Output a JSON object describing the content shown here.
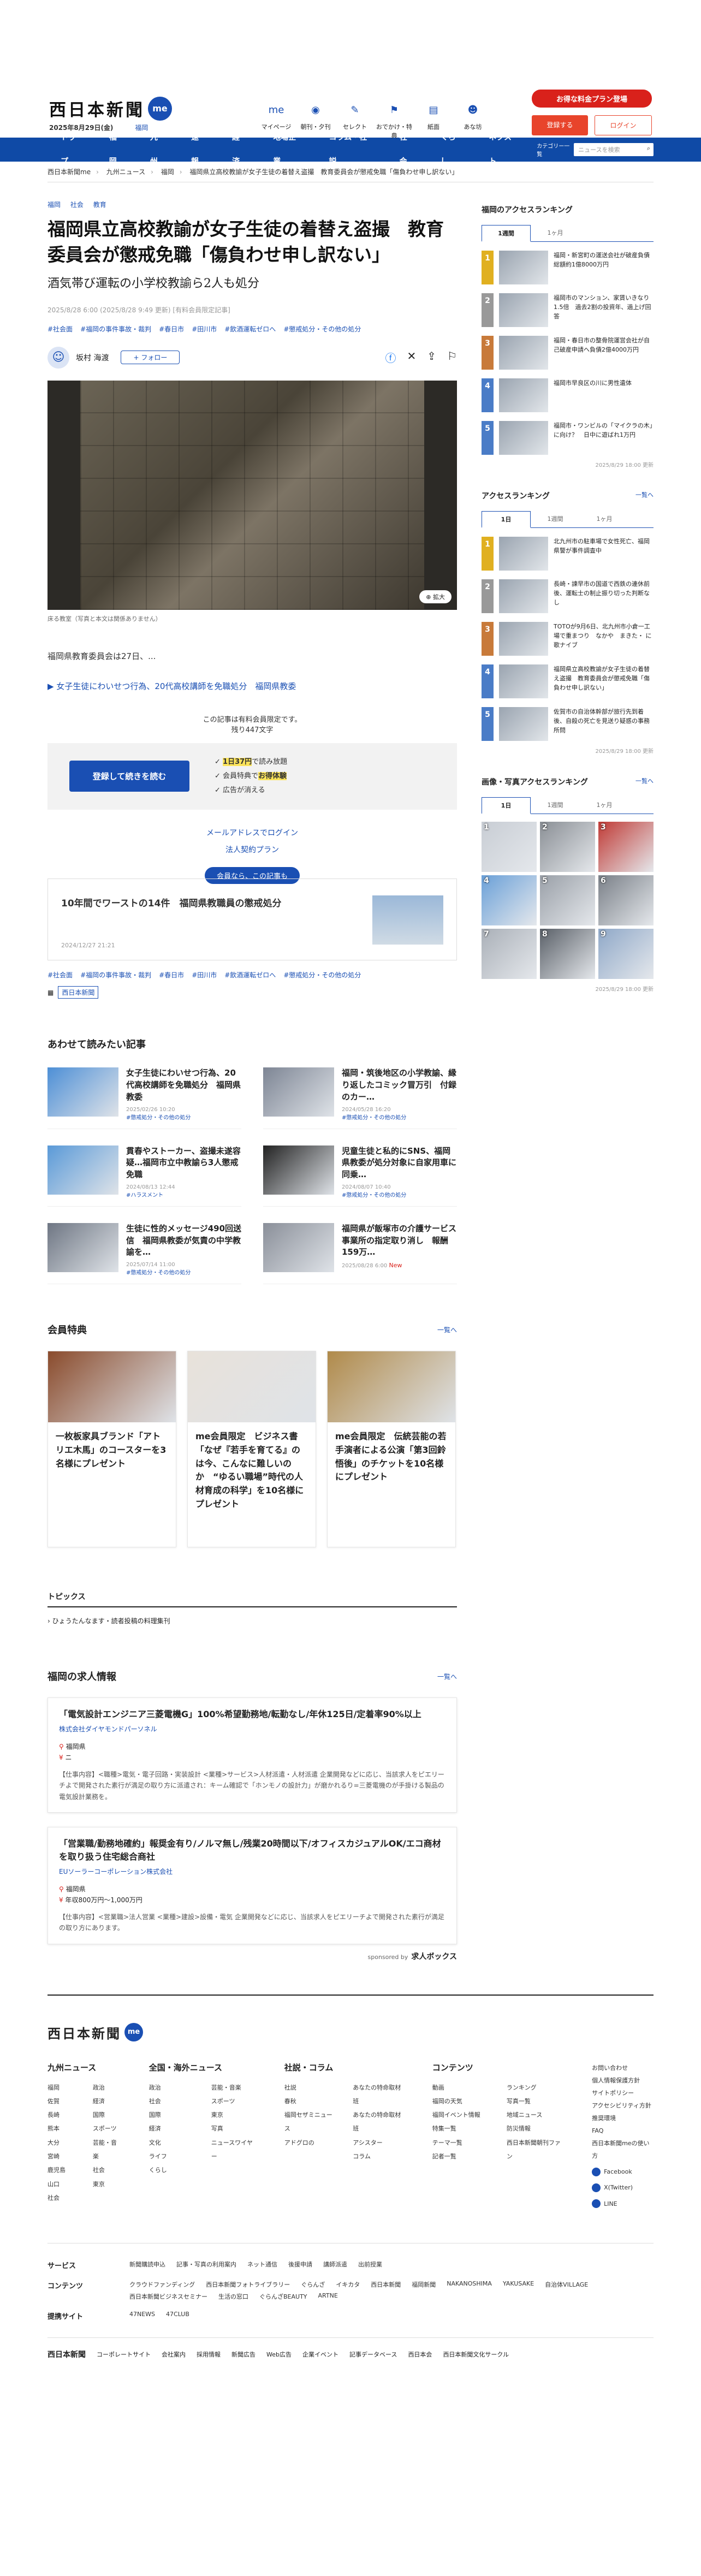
{
  "header": {
    "logo": "西日本新聞",
    "logo_badge": "me",
    "date": "2025年8月29日(金)",
    "region": "福岡",
    "nav": [
      {
        "icon": "my-page-icon",
        "label": "マイページ"
      },
      {
        "icon": "newspaper-icon",
        "label": "朝刊・夕刊"
      },
      {
        "icon": "select-icon",
        "label": "セレクト"
      },
      {
        "icon": "gift-icon",
        "label": "おでかけ・特典"
      },
      {
        "icon": "paper-icon",
        "label": "紙面"
      },
      {
        "icon": "asumaru-icon",
        "label": "あな坊"
      }
    ],
    "promo": "お得な料金プラン登場",
    "register": "登録する",
    "login": "ログイン"
  },
  "gnav": {
    "items": [
      "トップ",
      "福岡",
      "九州",
      "速報",
      "経済",
      "地場企業",
      "コラム・社説",
      "社会",
      "くらし",
      "ネクスト"
    ],
    "more": "カテゴリー一覧",
    "search_placeholder": "ニュースを検索"
  },
  "breadcrumb": [
    "西日本新聞me",
    "九州ニュース",
    "福岡",
    "福岡県立高校教諭が女子生徒の着替え盗撮　教育委員会が懲戒免職「傷負わせ申し訳ない」"
  ],
  "article": {
    "categories": [
      "福岡",
      "社会",
      "教育"
    ],
    "title": "福岡県立高校教諭が女子生徒の着替え盗撮　教育委員会が懲戒免職「傷負わせ申し訳ない」",
    "subtitle": "酒気帯び運転の小学校教諭ら2人も処分",
    "meta": "2025/8/28 6:00 (2025/8/28 9:49 更新) [有料会員限定記事]",
    "tags": [
      "#社会面",
      "#福岡の事件事故・裁判",
      "#春日市",
      "#田川市",
      "#飲酒運転ゼロへ",
      "#懲戒処分・その他の処分"
    ],
    "author": "坂村 海渡",
    "follow": "+ フォロー",
    "zoom": "拡大",
    "caption": "床る教室（写真と本文は関係ありません）",
    "lead": "福岡県教育委員会は27日、...",
    "related_link": "女子生徒にわいせつ行為、20代高校講師を免職処分　福岡県教委",
    "paywall_note1": "この記事は有料会員限定です。",
    "paywall_note2": "残り447文字",
    "paywall_btn": "登録して続きを読む",
    "benefits": [
      "1日37円で読み放題",
      "会員特典でお得体験",
      "広告が消える"
    ],
    "benefit_hl": [
      "1日37円",
      "お得体験"
    ],
    "login_mail": "メールアドレスでログイン",
    "corp_plan": "法人契約プラン",
    "member_badge": "会員なら、この記事も",
    "rec_title": "10年間でワーストの14件　福岡県教職員の懲戒処分",
    "rec_date": "2024/12/27 21:21",
    "tags2": [
      "#社会面",
      "#福岡の事件事故・裁判",
      "#春日市",
      "#田川市",
      "#飲酒運転ゼロへ",
      "#懲戒処分・その他の処分"
    ],
    "source": "西日本新聞"
  },
  "related": {
    "title": "あわせて読みたい記事",
    "items": [
      {
        "title": "女子生徒にわいせつ行為、20代高校講師を免職処分　福岡県教委",
        "date": "2025/02/26 10:20",
        "tag": "#懲戒処分・その他の処分",
        "color": "#4d8fd6"
      },
      {
        "title": "福岡・筑後地区の小学教諭、縁り返したコミック冒万引　付録のカー…",
        "date": "2024/05/28 16:20",
        "tag": "#懲戒処分・その他の処分",
        "color": "#7d8594"
      },
      {
        "title": "貫春やストーカー、盗撮未遂容疑…福岡市立中教諭ら3人懲戒免職",
        "date": "2024/08/13 12:44",
        "tag": "#ハラスメント",
        "color": "#5a9ad8"
      },
      {
        "title": "児童生徒と私的にSNS、福岡県教委が処分対象に自家用車に同乗…",
        "date": "2024/08/07 10:40",
        "tag": "#懲戒処分・その他の処分",
        "color": "#222222"
      },
      {
        "title": "生徒に性的メッセージ490回送信　福岡県教委が気責の中学教諭を…",
        "date": "2025/07/14 11:00",
        "tag": "#懲戒処分・その他の処分",
        "color": "#6e7683"
      },
      {
        "title": "福岡県が飯塚市の介護サービス事業所の指定取り消し　報酬159万…",
        "date": "2025/08/28 6:00",
        "tag": "",
        "new": "New",
        "color": "#8a8f99"
      }
    ]
  },
  "perks": {
    "title": "会員特典",
    "more": "一覧へ",
    "items": [
      {
        "title": "一枚板家具ブランド「アトリエ木馬」のコースターを3名様にプレゼント",
        "color": "#8a4b2c"
      },
      {
        "title": "me会員限定　ビジネス書「なぜ『若手を育てる』のは今、こんなに難しいのか　“ゆるい職場”時代の人材育成の科学」を10名様にプレゼント",
        "color": "#e8e2da"
      },
      {
        "title": "me会員限定　伝統芸能の若手演者による公演「第3回鈴悟後」のチケットを10名様にプレゼント",
        "color": "#b08a4a"
      }
    ]
  },
  "topics": {
    "title": "トピックス",
    "item": "ひょうたんなます・読者投稿の料理集刊"
  },
  "jobs": {
    "title": "福岡の求人情報",
    "more": "一覧へ",
    "items": [
      {
        "title": "「電気設計エンジニア三菱電機G」100%希望勤務地/転勤なし/年休125日/定着率90%以上",
        "company": "株式会社ダイヤモンドパーソネル",
        "place": "福岡県",
        "salary": "ニ",
        "body": "【仕事内容】<職種>電気・電子回路・実装設計 <業種>サービス>人材派遣・人材派遣 企業開発などに応じ、当該求人をピエリーチよで開発された素行が満足の取り方に派遣され：キーム確認で「ホンモノの設計力」が磨かれるり=三菱電機のが手掛ける製品の電気設計業務を。"
      },
      {
        "title": "「営業職/勤務地確約」報奨金有り/ノルマ無し/残業20時間以下/オフィスカジュアルOK/エコ商材を取り扱う住宅総合商社",
        "company": "EUソーラーコーポレーション株式会社",
        "place": "福岡県",
        "salary": "年収800万円～1,000万円",
        "body": "【仕事内容】<営業職>法人営業 <業種>建設>設備・電気 企業開発などに応じ、当該求人をピエリーチよで開発された素行が満足の取り方にあります。"
      }
    ],
    "sponsor": "sponsored by",
    "sponsor_brand": "求人ボックス"
  },
  "sidebar": {
    "fukuoka_title": "福岡のアクセスランキング",
    "tabs": [
      "1週間",
      "1ヶ月"
    ],
    "fukuoka_rank": [
      {
        "n": "1",
        "title": "福岡・新宮町の運送会社が破産負債総額約1億8000万円",
        "color": "#e0b020"
      },
      {
        "n": "2",
        "title": "福岡市のマンション、家賃いきなり1.5倍　過去2割の投資年、過上げ回答",
        "color": "#999999"
      },
      {
        "n": "3",
        "title": "福岡・春日市の整骨院運営会社が自己破産申請へ負債2億4000万円",
        "color": "#c87a3a"
      },
      {
        "n": "4",
        "title": "福岡市早良区の川に男性遺体",
        "color": "#4a7cc7"
      },
      {
        "n": "5",
        "title": "福岡市・ワンビルの「マイクラの木」に向け？　日中に遊ばれ1万円",
        "color": "#4a7cc7"
      }
    ],
    "fukuoka_upd": "2025/8/29 18:00 更新",
    "access_title": "アクセスランキング",
    "access_more": "一覧へ",
    "access_tabs": [
      "1日",
      "1週間",
      "1ヶ月"
    ],
    "access_rank": [
      {
        "n": "1",
        "title": "北九州市の駐車場で女性死亡、福岡県警が事件調査中",
        "color": "#e0b020"
      },
      {
        "n": "2",
        "title": "長崎・諫早市の国道で西鉄の連休前後、運転士の制止振り切った判断なし",
        "color": "#999999"
      },
      {
        "n": "3",
        "title": "TOTOが9月6日、北九州市小倉一工場で重まつり　なかや　まきた・ に歌ナイブ",
        "color": "#c87a3a"
      },
      {
        "n": "4",
        "title": "福岡県立高校教諭が女子生徒の着替え盗撮　教育委員会が懲戒免職「傷負わせ申し訳ない」",
        "color": "#4a7cc7"
      },
      {
        "n": "5",
        "title": "佐賀市の自治体幹部が旅行先到着後、自殺の死亡を見送り疑惑の事務所問",
        "color": "#4a7cc7"
      }
    ],
    "access_upd": "2025/8/29 18:00 更新",
    "photo_title": "画像・写真アクセスランキング",
    "photo_more": "一覧へ",
    "photo_tabs": [
      "1日",
      "1週間",
      "1ヶ月"
    ],
    "photos": [
      "#c8cdd4",
      "#8a8f95",
      "#c03a35",
      "#6aa0d8",
      "#9aa0a8",
      "#7a8088",
      "#aab0b8",
      "#5a6068",
      "#8fa8c8"
    ],
    "photo_upd": "2025/8/29 18:00 更新"
  },
  "footer": {
    "logo": "西日本新聞",
    "cols": [
      {
        "title": "九州ニュース",
        "items": [
          "福岡",
          "佐賀",
          "長崎",
          "熊本",
          "大分",
          "宮崎",
          "鹿児島",
          "山口",
          "社会",
          "政治",
          "経済",
          "国際",
          "スポーツ",
          "芸能・音楽",
          "社会",
          "東京"
        ]
      },
      {
        "title": "全国・海外ニュース",
        "items": [
          "政治",
          "社会",
          "国際",
          "経済",
          "文化",
          "ライフ",
          "くらし",
          "芸能・音楽",
          "スポーツ",
          "東京",
          "写真",
          "ニュースワイヤー"
        ]
      },
      {
        "title": "社説・コラム",
        "items": [
          "社説",
          "春秋",
          "福岡セザミニュース",
          "アドグロの",
          "",
          "あなたの特命取材班",
          "あなたの特命取材班",
          "アシスター",
          "コラム"
        ]
      },
      {
        "title": "コンテンツ",
        "items": [
          "動画",
          "福岡の天気",
          "福岡イベント情報",
          "特集一覧",
          "テーマ一覧",
          "記者一覧",
          "ランキング",
          "写真一覧",
          "地域ニュース",
          "防災情報",
          "西日本新聞朝刊ファン"
        ]
      }
    ],
    "side_links": [
      "お問い合わせ",
      "個人情報保護方針",
      "サイトポリシー",
      "アクセシビリティ方針",
      "推奨環境",
      "FAQ",
      "西日本新聞meの使い方",
      "Facebook",
      "X(Twitter)",
      "LINE"
    ],
    "rows": [
      {
        "label": "サービス",
        "items": [
          "新聞購読申込",
          "記事・写真の利用案内",
          "ネット通信",
          "後援申請",
          "講師派遣",
          "出前授業"
        ]
      },
      {
        "label": "コンテンツ",
        "items": [
          "クラウドファンディング",
          "西日本新聞フォトライブラリー",
          "ぐらんざ",
          "イキカタ",
          "西日本新聞",
          "福岡新聞",
          "NAKANOSHIMA",
          "YAKUSAKE",
          "自治体VILLAGE",
          "西日本新聞ビジネスセミナー",
          "生活の窓口",
          "ぐらんざBEAUTY",
          "ARTNE"
        ]
      },
      {
        "label": "提携サイト",
        "items": [
          "47NEWS",
          "47CLUB"
        ]
      }
    ],
    "bottom": [
      "コーポレートサイト",
      "会社案内",
      "採用情報",
      "新聞広告",
      "Web広告",
      "企業イベント",
      "記事データベース",
      "西日本会",
      "西日本新聞文化サークル"
    ],
    "mini_logo": "西日本新聞"
  }
}
